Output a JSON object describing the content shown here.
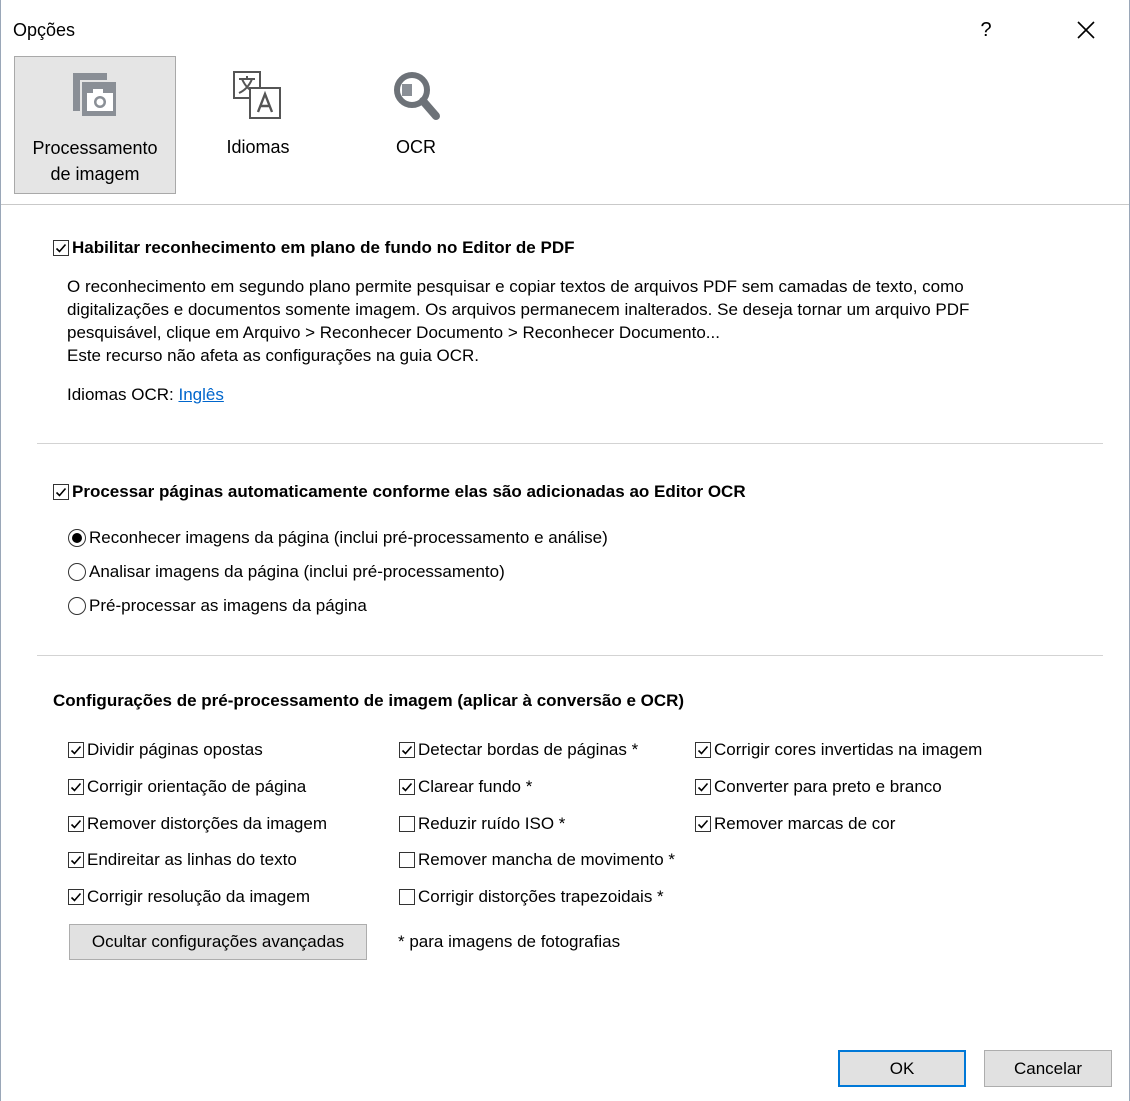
{
  "window": {
    "title": "Opções",
    "help_label": "?",
    "close_icon": "close-icon"
  },
  "tabs": [
    {
      "label_line1": "Processamento",
      "label_line2": "de imagem",
      "icon": "image-processing-icon",
      "active": true
    },
    {
      "label_line1": "Idiomas",
      "icon": "languages-icon",
      "active": false
    },
    {
      "label_line1": "OCR",
      "icon": "ocr-magnifier-icon",
      "active": false
    }
  ],
  "background": {
    "checkbox_label": "Habilitar reconhecimento em plano de fundo no Editor de PDF",
    "checked": true,
    "description_lines": [
      "O reconhecimento em segundo plano permite pesquisar e copiar textos de arquivos PDF sem camadas de texto, como",
      "digitalizações e documentos somente imagem. Os arquivos permanecem inalterados. Se deseja tornar um arquivo PDF",
      "pesquisável, clique em Arquivo > Reconhecer Documento > Reconhecer Documento...",
      "Este recurso não afeta as configurações na guia OCR."
    ],
    "ocr_languages_label": "Idiomas OCR:",
    "ocr_languages_value": "Inglês"
  },
  "auto_process": {
    "checkbox_label": "Processar páginas automaticamente conforme elas são adicionadas ao Editor OCR",
    "checked": true,
    "options": [
      {
        "label": "Reconhecer imagens da página (inclui pré-processamento e análise)",
        "selected": true
      },
      {
        "label": "Analisar imagens da página (inclui pré-processamento)",
        "selected": false
      },
      {
        "label": "Pré-processar as imagens da página",
        "selected": false
      }
    ]
  },
  "preprocessing": {
    "heading": "Configurações de pré-processamento de imagem (aplicar à conversão e OCR)",
    "col1": [
      {
        "label": "Dividir páginas opostas",
        "checked": true
      },
      {
        "label": "Corrigir orientação de página",
        "checked": true
      },
      {
        "label": "Remover distorções da imagem",
        "checked": true
      },
      {
        "label": "Endireitar as linhas do texto",
        "checked": true
      },
      {
        "label": "Corrigir resolução da imagem",
        "checked": true
      }
    ],
    "col2": [
      {
        "label": "Detectar bordas de páginas *",
        "checked": true
      },
      {
        "label": "Clarear fundo *",
        "checked": true
      },
      {
        "label": "Reduzir ruído ISO *",
        "checked": false
      },
      {
        "label": "Remover mancha de movimento *",
        "checked": false
      },
      {
        "label": "Corrigir distorções trapezoidais *",
        "checked": false
      }
    ],
    "col3": [
      {
        "label": "Corrigir cores invertidas na imagem",
        "checked": true
      },
      {
        "label": "Converter para preto e branco",
        "checked": true
      },
      {
        "label": "Remover marcas de cor",
        "checked": true
      }
    ],
    "hide_advanced_button": "Ocultar configurações avançadas",
    "footnote": "* para imagens de fotografias"
  },
  "footer": {
    "ok_label": "OK",
    "cancel_label": "Cancelar"
  },
  "colors": {
    "link": "#0066cc",
    "accent": "#0078d7",
    "tab_active_bg": "#e5e5e5"
  }
}
